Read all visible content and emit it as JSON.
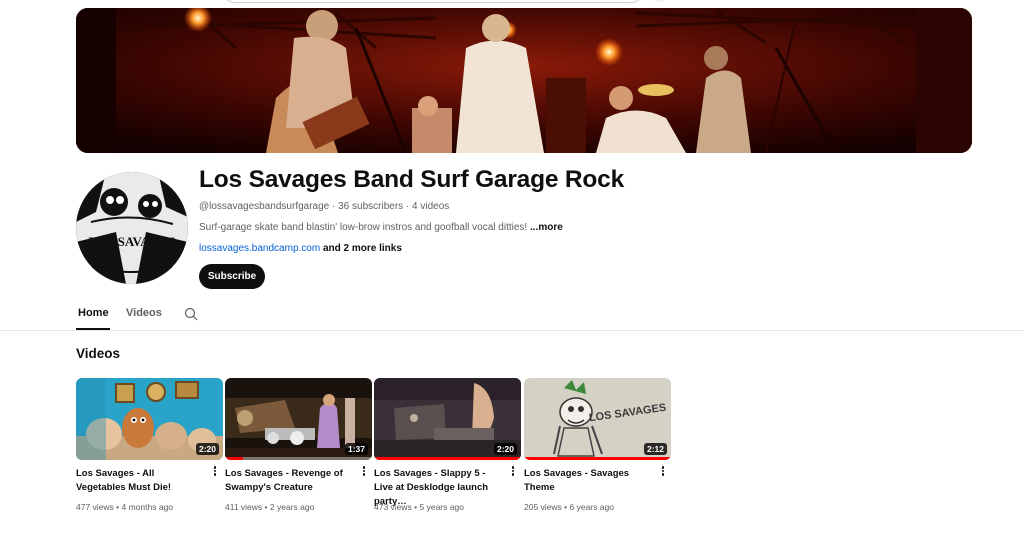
{
  "channel": {
    "title": "Los Savages Band Surf Garage Rock",
    "handle": "@lossavagesbandsurfgarage",
    "subscribers": "36 subscribers",
    "video_count": "4 videos",
    "description": "Surf-garage skate band blastin' low-brow instros and goofball vocal ditties!",
    "more_label": "...more",
    "link_text": "lossavages.bandcamp.com",
    "more_links": "and 2 more links",
    "subscribe_label": "Subscribe",
    "avatar_text": "LOS SAVAGES"
  },
  "tabs": [
    {
      "label": "Home",
      "active": true
    },
    {
      "label": "Videos",
      "active": false
    }
  ],
  "section_title": "Videos",
  "videos": [
    {
      "title": "Los Savages - All Vegetables Must Die!",
      "views": "477 views",
      "age": "4 months ago",
      "duration": "2:20",
      "progress_pct": 0
    },
    {
      "title": "Los Savages - Revenge of Swampy's Creature",
      "views": "411 views",
      "age": "2 years ago",
      "duration": "1:37",
      "progress_pct": 12
    },
    {
      "title": "Los Savages - Slappy 5 - Live at Desklodge launch party…",
      "views": "473 views",
      "age": "5 years ago",
      "duration": "2:20",
      "progress_pct": 100
    },
    {
      "title": "Los Savages - Savages Theme",
      "views": "205 views",
      "age": "6 years ago",
      "duration": "2:12",
      "progress_pct": 100
    }
  ],
  "thumb_texts": {
    "v4": "LOS SAVAGES"
  },
  "colors": {
    "progress": "#ff0000",
    "link": "#065fd4",
    "subscribe_bg": "#0f0f0f"
  }
}
